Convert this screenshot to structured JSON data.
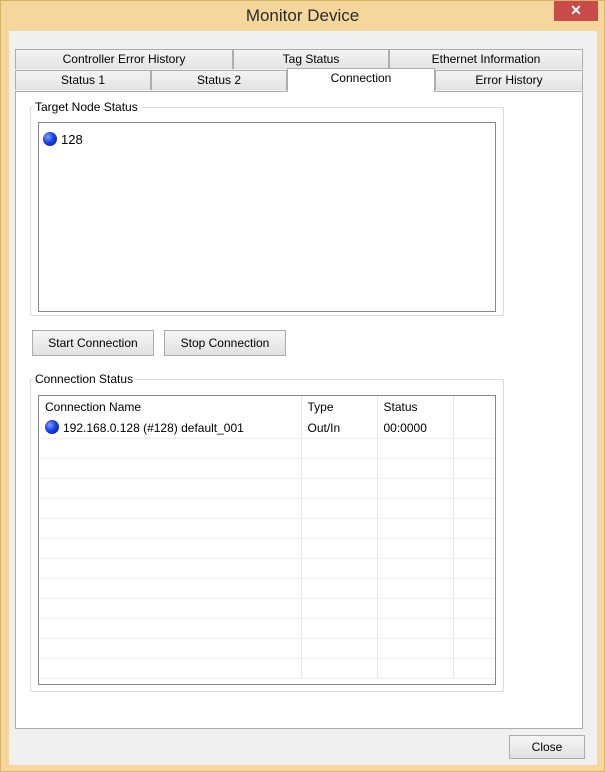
{
  "window": {
    "title": "Monitor Device",
    "close_glyph": "✕"
  },
  "tabs": {
    "row1": [
      "Controller Error History",
      "Tag Status",
      "Ethernet Information"
    ],
    "row2": [
      "Status 1",
      "Status 2",
      "Connection",
      "Error History"
    ],
    "selected": "Connection"
  },
  "target_node": {
    "legend": "Target Node Status",
    "items": [
      {
        "icon": "blue-status-dot-icon",
        "label": "128"
      }
    ]
  },
  "buttons": {
    "start": "Start Connection",
    "stop": "Stop Connection",
    "close": "Close"
  },
  "connection_status": {
    "legend": "Connection Status",
    "columns": [
      "Connection Name",
      "Type",
      "Status"
    ],
    "rows": [
      {
        "icon": "blue-status-dot-icon",
        "name": "192.168.0.128 (#128) default_001",
        "type": "Out/In",
        "status": "00:0000"
      }
    ]
  },
  "colors": {
    "titlebar": "#f5d79b",
    "close_button": "#c74b49",
    "status_dot": "#1b3fe0"
  }
}
